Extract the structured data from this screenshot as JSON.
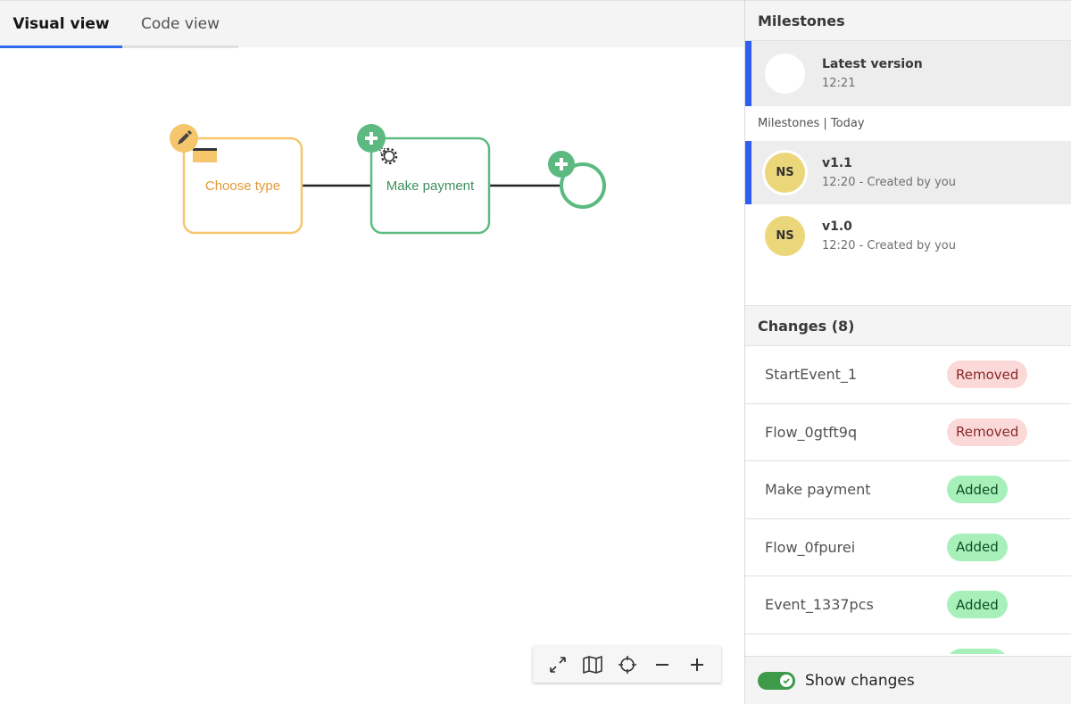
{
  "tabs": [
    {
      "label": "Visual view",
      "active": true
    },
    {
      "label": "Code view",
      "active": false
    }
  ],
  "diagram": {
    "nodes": [
      {
        "id": "choose-type",
        "type": "task",
        "label": "Choose type",
        "status": "modified",
        "badge_icon": "pencil-icon",
        "marker_icon": "manual-task-icon",
        "color": "#f5c66b",
        "text_color": "#e09a35"
      },
      {
        "id": "make-payment",
        "type": "service-task",
        "label": "Make payment",
        "status": "added",
        "badge_icon": "plus-icon",
        "marker_icon": "gear-icon",
        "color": "#5cba80",
        "text_color": "#3e8f5e"
      },
      {
        "id": "end-event",
        "type": "end-event",
        "label": "",
        "status": "added",
        "badge_icon": "plus-icon",
        "color": "#5cba80"
      }
    ],
    "edges": [
      {
        "from": "choose-type",
        "to": "make-payment"
      },
      {
        "from": "make-payment",
        "to": "end-event"
      }
    ]
  },
  "toolbar": {
    "buttons": [
      {
        "name": "fullscreen",
        "icon": "expand-icon"
      },
      {
        "name": "minimap",
        "icon": "map-icon"
      },
      {
        "name": "center",
        "icon": "crosshair-icon"
      },
      {
        "name": "zoom-out",
        "icon": "minus-icon"
      },
      {
        "name": "zoom-in",
        "icon": "plus-icon"
      }
    ]
  },
  "milestones": {
    "title": "Milestones",
    "latest": {
      "title": "Latest version",
      "time": "12:21"
    },
    "group_label": "Milestones | Today",
    "items": [
      {
        "initials": "NS",
        "title": "v1.1",
        "subtitle": "12:20 - Created by you",
        "selected": true
      },
      {
        "initials": "NS",
        "title": "v1.0",
        "subtitle": "12:20 - Created by you",
        "selected": false
      }
    ]
  },
  "changes": {
    "title": "Changes (8)",
    "count": 8,
    "items": [
      {
        "name": "StartEvent_1",
        "status": "Removed"
      },
      {
        "name": "Flow_0gtft9q",
        "status": "Removed"
      },
      {
        "name": "Make payment",
        "status": "Added"
      },
      {
        "name": "Flow_0fpurei",
        "status": "Added"
      },
      {
        "name": "Event_1337pcs",
        "status": "Added"
      },
      {
        "name": "",
        "status": "Added"
      }
    ]
  },
  "footer": {
    "toggle_label": "Show changes",
    "toggle_on": true
  },
  "colors": {
    "accent": "#2f5ef5",
    "modified": "#f5c66b",
    "added": "#5cba80",
    "removed_badge_bg": "#fbd9d9",
    "added_badge_bg": "#a7f0ba",
    "toggle_on": "#3e9a49"
  }
}
